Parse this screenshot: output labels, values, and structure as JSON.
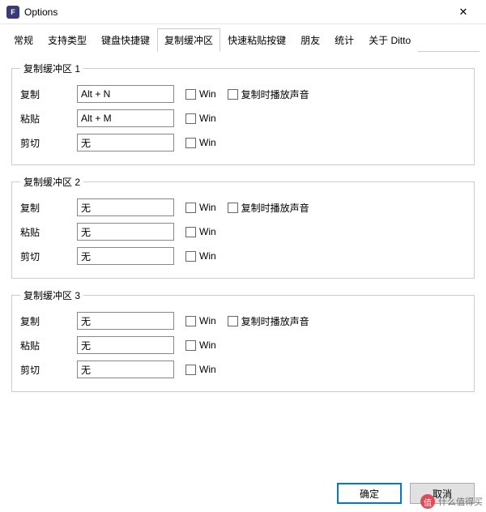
{
  "window": {
    "title": "Options",
    "close_glyph": "✕"
  },
  "tabs": {
    "items": [
      "常规",
      "支持类型",
      "键盘快捷键",
      "复制缓冲区",
      "快速粘贴按键",
      "朋友",
      "统计",
      "关于 Ditto"
    ],
    "active_index": 3
  },
  "labels": {
    "copy": "复制",
    "paste": "粘贴",
    "cut": "剪切",
    "win": "Win",
    "play_sound": "复制时播放声音"
  },
  "groups": [
    {
      "legend": "复制缓冲区 1",
      "rows": [
        {
          "label_key": "copy",
          "value": "Alt + N",
          "win": false,
          "sound_visible": true,
          "sound": false
        },
        {
          "label_key": "paste",
          "value": "Alt + M",
          "win": false,
          "sound_visible": false
        },
        {
          "label_key": "cut",
          "value": "无",
          "win": false,
          "sound_visible": false
        }
      ]
    },
    {
      "legend": "复制缓冲区 2",
      "rows": [
        {
          "label_key": "copy",
          "value": "无",
          "win": false,
          "sound_visible": true,
          "sound": false
        },
        {
          "label_key": "paste",
          "value": "无",
          "win": false,
          "sound_visible": false
        },
        {
          "label_key": "cut",
          "value": "无",
          "win": false,
          "sound_visible": false
        }
      ]
    },
    {
      "legend": "复制缓冲区 3",
      "rows": [
        {
          "label_key": "copy",
          "value": "无",
          "win": false,
          "sound_visible": true,
          "sound": false
        },
        {
          "label_key": "paste",
          "value": "无",
          "win": false,
          "sound_visible": false
        },
        {
          "label_key": "cut",
          "value": "无",
          "win": false,
          "sound_visible": false
        }
      ]
    }
  ],
  "footer": {
    "ok": "确定",
    "cancel": "取消"
  },
  "watermark": {
    "icon": "值",
    "text": "什么值得买"
  }
}
